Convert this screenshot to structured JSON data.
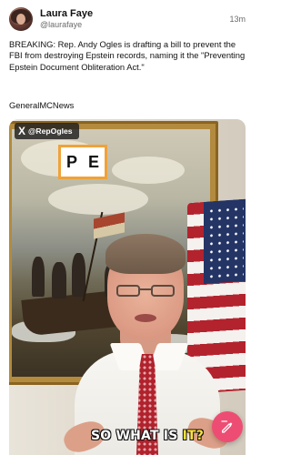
{
  "post": {
    "author_name": "Laura Faye",
    "author_handle": "@laurafaye",
    "timestamp": "13m",
    "body": "BREAKING: Rep. Andy Ogles is drafting a bill to prevent the FBI from destroying Epstein records, naming it the \"Preventing Epstein Document Obliteration Act.\"",
    "source": "GeneralMCNews"
  },
  "media": {
    "watermark_logo": "X",
    "watermark_handle": "@RepOgles",
    "sign_letters": [
      "P",
      "E"
    ],
    "caption_prefix": "SO WHAT IS ",
    "caption_highlight": "IT?"
  },
  "fab": {
    "icon": "compose-icon",
    "color": "#ee4d73"
  }
}
